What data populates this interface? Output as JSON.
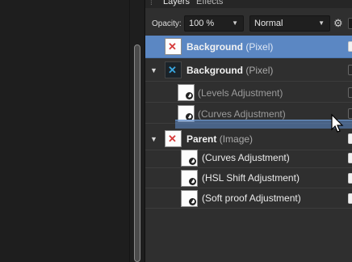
{
  "tabs": [
    {
      "label": "Layers",
      "active": true
    },
    {
      "label": "Effects",
      "active": false
    }
  ],
  "options": {
    "opacity_label": "Opacity:",
    "opacity_value": "100 %",
    "blend_mode": "Normal"
  },
  "layers": [
    {
      "name": "Background",
      "kind": "(Pixel)",
      "selected": true
    },
    {
      "name": "Background",
      "kind": "(Pixel)"
    },
    {
      "label": "(Levels Adjustment)"
    },
    {
      "label": "(Curves Adjustment)"
    },
    {
      "name": "Parent",
      "kind": "(Image)"
    },
    {
      "label": "(Curves Adjustment)"
    },
    {
      "label": "(HSL Shift Adjustment)"
    },
    {
      "label": "(Soft proof Adjustment)"
    }
  ],
  "colors": {
    "selection": "#5b87c3",
    "panel_bg": "#2f2f2f"
  }
}
